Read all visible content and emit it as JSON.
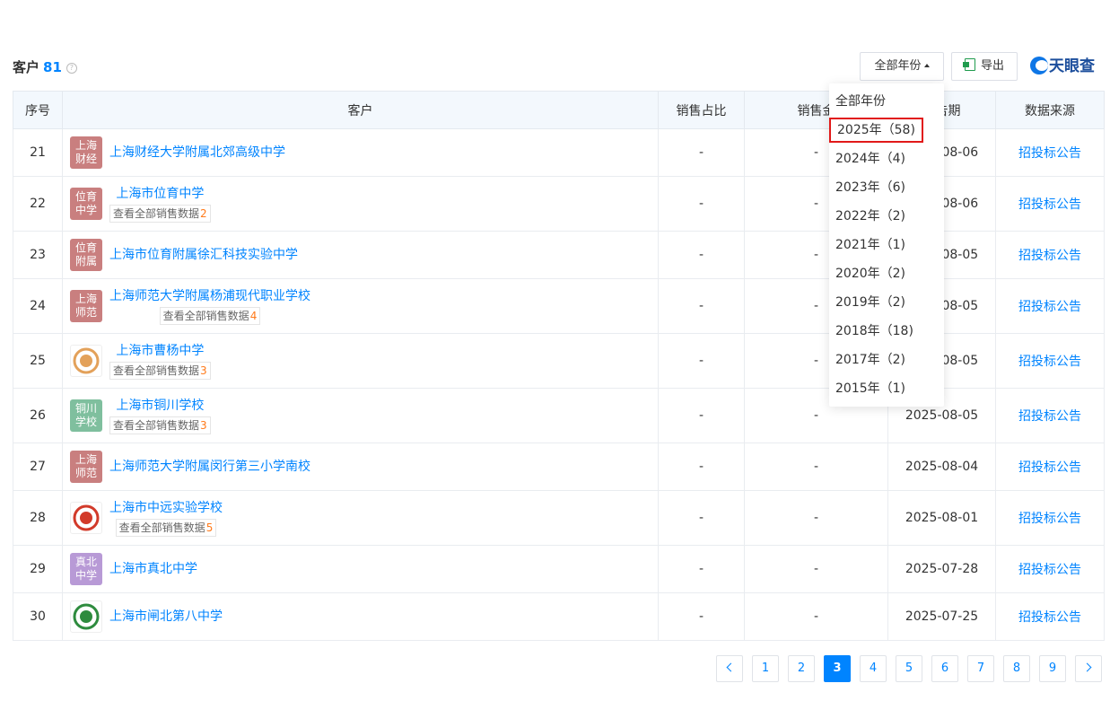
{
  "header": {
    "title": "客户",
    "count": "81",
    "help_glyph": "?",
    "year_filter_label": "全部年份",
    "export_label": "导出",
    "brand": "天眼查"
  },
  "table": {
    "columns": [
      "序号",
      "客户",
      "销售占比",
      "销售金",
      "报告期",
      "数据来源"
    ],
    "rows": [
      {
        "index": "21",
        "logo_text": "上海财经",
        "logo_color": "#c97f7f",
        "name": "上海财经大学附属北郊高级中学",
        "sub_label": "",
        "sub_count": "",
        "share": "-",
        "amount": "-",
        "date": "2025-08-06",
        "source": "招投标公告"
      },
      {
        "index": "22",
        "logo_text": "位育中学",
        "logo_color": "#c97f7f",
        "name": "上海市位育中学",
        "sub_label": "查看全部销售数据",
        "sub_count": "2",
        "share": "-",
        "amount": "-",
        "date": "2025-08-06",
        "source": "招投标公告"
      },
      {
        "index": "23",
        "logo_text": "位育附属",
        "logo_color": "#c97f7f",
        "name": "上海市位育附属徐汇科技实验中学",
        "sub_label": "",
        "sub_count": "",
        "share": "-",
        "amount": "-",
        "date": "2025-08-05",
        "source": "招投标公告"
      },
      {
        "index": "24",
        "logo_text": "上海师范",
        "logo_color": "#c97f7f",
        "name": "上海师范大学附属杨浦现代职业学校",
        "sub_label": "查看全部销售数据",
        "sub_count": "4",
        "share": "-",
        "amount": "-",
        "date": "2025-08-05",
        "source": "招投标公告"
      },
      {
        "index": "25",
        "logo_text": "",
        "logo_color": "#e3a15a",
        "name": "上海市曹杨中学",
        "sub_label": "查看全部销售数据",
        "sub_count": "3",
        "share": "-",
        "amount": "-",
        "date": "2025-08-05",
        "source": "招投标公告"
      },
      {
        "index": "26",
        "logo_text": "铜川学校",
        "logo_color": "#7fbf9e",
        "name": "上海市铜川学校",
        "sub_label": "查看全部销售数据",
        "sub_count": "3",
        "share": "-",
        "amount": "-",
        "date": "2025-08-05",
        "source": "招投标公告"
      },
      {
        "index": "27",
        "logo_text": "上海师范",
        "logo_color": "#c97f7f",
        "name": "上海师范大学附属闵行第三小学南校",
        "sub_label": "",
        "sub_count": "",
        "share": "-",
        "amount": "-",
        "date": "2025-08-04",
        "source": "招投标公告"
      },
      {
        "index": "28",
        "logo_text": "",
        "logo_color": "#d23a2a",
        "name": "上海市中远实验学校",
        "sub_label": "查看全部销售数据",
        "sub_count": "5",
        "share": "-",
        "amount": "-",
        "date": "2025-08-01",
        "source": "招投标公告"
      },
      {
        "index": "29",
        "logo_text": "真北中学",
        "logo_color": "#b89ad6",
        "name": "上海市真北中学",
        "sub_label": "",
        "sub_count": "",
        "share": "-",
        "amount": "-",
        "date": "2025-07-28",
        "source": "招投标公告"
      },
      {
        "index": "30",
        "logo_text": "",
        "logo_color": "#2e8b3e",
        "name": "上海市闸北第八中学",
        "sub_label": "",
        "sub_count": "",
        "share": "-",
        "amount": "-",
        "date": "2025-07-25",
        "source": "招投标公告"
      }
    ]
  },
  "dropdown": {
    "items": [
      "全部年份",
      "2025年（58)",
      "2024年（4)",
      "2023年（6)",
      "2022年（2)",
      "2021年（1)",
      "2020年（2)",
      "2019年（2)",
      "2018年（18)",
      "2017年（2)",
      "2015年（1)"
    ],
    "selected_index": 1
  },
  "pagination": {
    "pages": [
      "1",
      "2",
      "3",
      "4",
      "5",
      "6",
      "7",
      "8",
      "9"
    ],
    "current": "3"
  },
  "colors": {
    "accent": "#0084ff",
    "count_highlight": "#ff7a1a",
    "selection_outline": "#e11919"
  }
}
